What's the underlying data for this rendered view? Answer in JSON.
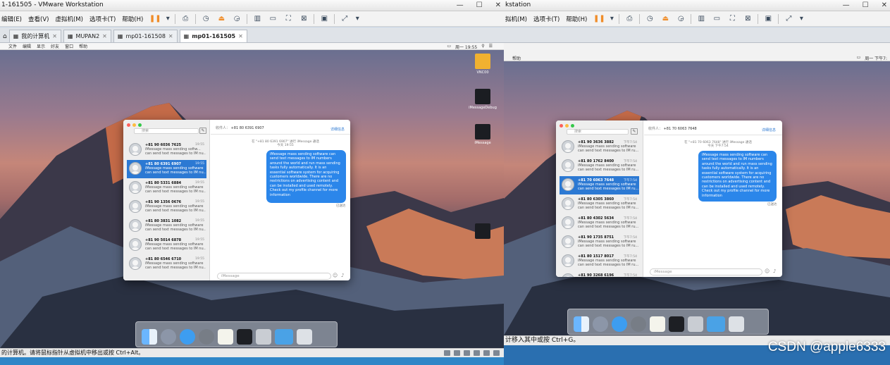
{
  "left": {
    "window_title": "1-161505 - VMware Workstation",
    "menu": [
      "编辑(E)",
      "查看(V)",
      "虚拟机(M)",
      "选项卡(T)",
      "帮助(H)"
    ],
    "tabs": [
      "我的计算机",
      "MUPAN2",
      "mp01-161508",
      "mp01-161505"
    ],
    "vm_menu": [
      "文件",
      "编辑",
      "显示",
      "好友",
      "窗口",
      "帮助"
    ],
    "vm_clock": "周一 19:55",
    "desktop_icons": [
      "VNC00",
      "iMessageDebug",
      "iMessage"
    ],
    "status_text": "的计算机。请将鼠标指针从虚拟机中移出或按 Ctrl+Alt。",
    "messages": {
      "search_placeholder": "搜索",
      "recipient_label": "收件人：",
      "recipient": "+81 80 6391 6907",
      "details": "详细信息",
      "note1": "在 \"+81 80 6391 6907\" 进行 iMessage 通话",
      "note2": "今天 19:55",
      "bubble": "iMessage mass sending software can send text messages to IM numbers around the world and run mass sending tasks fully automatically. It is an essential software system for acquiring customers worldwide. There are no restrictions on advertising content and can be installed and used remotely. Check out my profile channel for more information",
      "delivered": "已送达",
      "input_placeholder": "iMessage",
      "conversations": [
        {
          "number": "+81 90 6036 7625",
          "time": "19:55",
          "l1": "iMessage mass sending softw...",
          "l2": "can send text messages to IM nu..."
        },
        {
          "number": "+81 80 6391 6907",
          "time": "19:55",
          "l1": "iMessage mass sending software",
          "l2": "can send text messages to IM nu..."
        },
        {
          "number": "+81 80 5331 6884",
          "time": "19:55",
          "l1": "iMessage mass sending software",
          "l2": "can send text messages to IM nu..."
        },
        {
          "number": "+81 90 1356 0676",
          "time": "19:55",
          "l1": "iMessage mass sending software",
          "l2": "can send text messages to IM nu..."
        },
        {
          "number": "+81 80 3831 1082",
          "time": "19:55",
          "l1": "iMessage mass sending software",
          "l2": "can send text messages to IM nu..."
        },
        {
          "number": "+81 90 5014 6878",
          "time": "19:55",
          "l1": "iMessage mass sending software",
          "l2": "can send text messages to IM nu..."
        },
        {
          "number": "+81 80 6546 6710",
          "time": "19:55",
          "l1": "iMessage mass sending software",
          "l2": "can send text messages to IM nu..."
        }
      ]
    }
  },
  "right": {
    "window_title": "kstation",
    "menu": [
      "拟机(M)",
      "选项卡(T)",
      "帮助(H)"
    ],
    "vm_menu": [
      "帮助"
    ],
    "vm_clock": "周一 下午7:",
    "status_text": "计移入其中或按 Ctrl+G。",
    "messages": {
      "search_placeholder": "搜索",
      "recipient_label": "收件人：",
      "recipient": "+81 70 6063 7648",
      "details": "详细信息",
      "note1": "在 \"+81 70 6063 7648\" 进行 iMessage 通话",
      "note2": "今天 下午7:54",
      "bubble": "iMessage mass sending software can send text messages to IM numbers around the world and run mass sending tasks fully automatically. It is an essential software system for acquiring customers worldwide. There are no restrictions on advertising content and can be installed and used remotely. Check out my profile channel for more information",
      "delivered": "已送达",
      "input_placeholder": "iMessage",
      "conversations": [
        {
          "number": "+81 90 3636 3882",
          "time": "下午7:54",
          "l1": "iMessage mass sending software",
          "l2": "can send text messages to IM ru..."
        },
        {
          "number": "+81 80 1762 8400",
          "time": "下午7:54",
          "l1": "iMessage mass sending software",
          "l2": "can send text messages to IM ru..."
        },
        {
          "number": "+81 70 6063 7648",
          "time": "下午7:54",
          "l1": "iMessage mass sending software",
          "l2": "can send text messages to IM ru..."
        },
        {
          "number": "+81 80 6305 3860",
          "time": "下午7:54",
          "l1": "iMessage mass sending software",
          "l2": "can send text messages to IM ru..."
        },
        {
          "number": "+81 80 4302 5634",
          "time": "下午7:54",
          "l1": "iMessage mass sending software",
          "l2": "can send text messages to IM ru..."
        },
        {
          "number": "+81 90 1735 8751",
          "time": "下午7:54",
          "l1": "iMessage mass sending software",
          "l2": "can send text messages to IM ru..."
        },
        {
          "number": "+81 80 1517 8017",
          "time": "下午7:54",
          "l1": "iMessage mass sending software",
          "l2": "can send text messages to IM ru..."
        },
        {
          "number": "+81 90 3268 6196",
          "time": "下午7:54",
          "l1": "iMessage mass sending software",
          "l2": "can send text messages to IM ru..."
        }
      ]
    }
  },
  "watermark": "CSDN @apple6333",
  "colors": {
    "selection": "#2c79d3",
    "bubble": "#2b86ea",
    "accent": "#f08c28"
  }
}
